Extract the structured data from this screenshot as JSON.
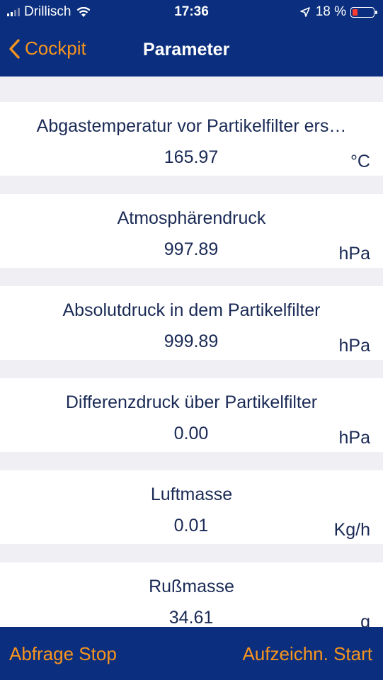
{
  "status_bar": {
    "carrier": "Drillisch",
    "time": "17:36",
    "battery_percent": "18 %",
    "battery_level": 0.18
  },
  "navbar": {
    "back_label": "Cockpit",
    "title": "Parameter"
  },
  "parameters": [
    {
      "label": "Abgastemperatur vor Partikelfilter ers…",
      "value": "165.97",
      "unit": "°C"
    },
    {
      "label": "Atmosphärendruck",
      "value": "997.89",
      "unit": "hPa"
    },
    {
      "label": "Absolutdruck in dem Partikelfilter",
      "value": "999.89",
      "unit": "hPa"
    },
    {
      "label": "Differenzdruck über Partikelfilter",
      "value": "0.00",
      "unit": "hPa"
    },
    {
      "label": "Luftmasse",
      "value": "0.01",
      "unit": "Kg/h"
    },
    {
      "label": "Rußmasse",
      "value": "34.61",
      "unit": "g"
    }
  ],
  "footer": {
    "left_label": "Abfrage Stop",
    "right_label": "Aufzeichn. Start"
  },
  "colors": {
    "bar_background": "#0b2f7e",
    "accent": "#f7941d",
    "text": "#1a2a55",
    "page_background": "#efeff4",
    "battery_low": "#ff3b30"
  }
}
